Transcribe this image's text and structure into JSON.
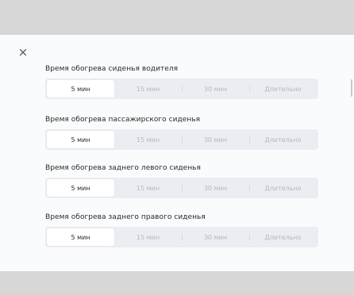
{
  "dialog": {
    "close_icon": "close-icon",
    "sections": [
      {
        "title": "Время обогрева сиденья водителя",
        "options": [
          "5 мин",
          "15 мин",
          "30 мин",
          "Длительно"
        ],
        "selected": "5 мин"
      },
      {
        "title": "Время обогрева пассажирского сиденья",
        "options": [
          "5 мин",
          "15 мин",
          "30 мин",
          "Длительно"
        ],
        "selected": "5 мин"
      },
      {
        "title": "Время обогрева заднего левого сиденья",
        "options": [
          "5 мин",
          "15 мин",
          "30 мин",
          "Длительно"
        ],
        "selected": "5 мин"
      },
      {
        "title": "Время обогрева заднего правого сиденья",
        "options": [
          "5 мин",
          "15 мин",
          "30 мин",
          "Длительно"
        ],
        "selected": "5 мин"
      }
    ]
  }
}
